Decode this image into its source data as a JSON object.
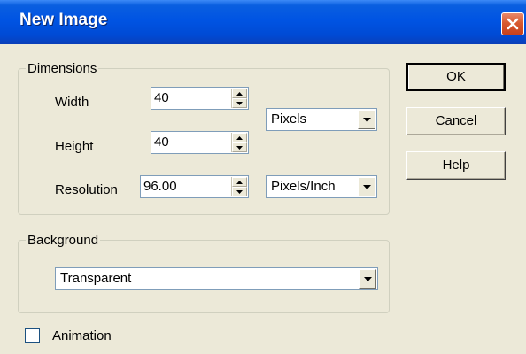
{
  "window": {
    "title": "New Image"
  },
  "dimensions": {
    "group_label": "Dimensions",
    "width_label": "Width",
    "width_value": "40",
    "height_label": "Height",
    "height_value": "40",
    "resolution_label": "Resolution",
    "resolution_value": "96.00",
    "unit_value": "Pixels",
    "resolution_unit_value": "Pixels/Inch"
  },
  "background": {
    "group_label": "Background",
    "value": "Transparent"
  },
  "animation": {
    "label": "Animation",
    "checked": false
  },
  "buttons": {
    "ok": "OK",
    "cancel": "Cancel",
    "help": "Help"
  },
  "colors": {
    "titlebar": "#0054e3",
    "dialog_bg": "#ece9d8",
    "close": "#d85a30"
  }
}
